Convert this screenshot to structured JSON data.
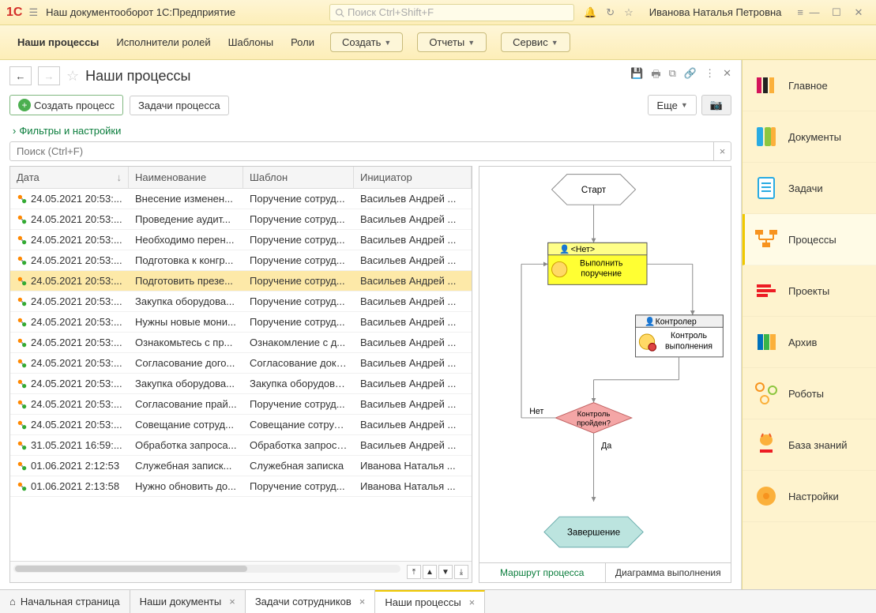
{
  "titlebar": {
    "app_title": "Наш документооборот 1С:Предприятие",
    "search_placeholder": "Поиск Ctrl+Shift+F",
    "username": "Иванова Наталья Петровна"
  },
  "toolbar": {
    "tabs": [
      "Наши процессы",
      "Исполнители ролей",
      "Шаблоны",
      "Роли"
    ],
    "create": "Создать",
    "reports": "Отчеты",
    "service": "Сервис"
  },
  "page": {
    "title": "Наши процессы",
    "create_process": "Создать процесс",
    "process_tasks": "Задачи процесса",
    "more": "Еще",
    "filters": "Фильтры и настройки",
    "search_placeholder": "Поиск (Ctrl+F)"
  },
  "table": {
    "columns": {
      "date": "Дата",
      "name": "Наименование",
      "template": "Шаблон",
      "initiator": "Инициатор"
    },
    "rows": [
      {
        "date": "24.05.2021 20:53:...",
        "name": "Внесение изменен...",
        "template": "Поручение сотруд...",
        "initiator": "Васильев Андрей ..."
      },
      {
        "date": "24.05.2021 20:53:...",
        "name": "Проведение аудит...",
        "template": "Поручение сотруд...",
        "initiator": "Васильев Андрей ..."
      },
      {
        "date": "24.05.2021 20:53:...",
        "name": "Необходимо перен...",
        "template": "Поручение сотруд...",
        "initiator": "Васильев Андрей ..."
      },
      {
        "date": "24.05.2021 20:53:...",
        "name": "Подготовка к конгр...",
        "template": "Поручение сотруд...",
        "initiator": "Васильев Андрей ..."
      },
      {
        "date": "24.05.2021 20:53:...",
        "name": "Подготовить презе...",
        "template": "Поручение сотруд...",
        "initiator": "Васильев Андрей ...",
        "selected": true
      },
      {
        "date": "24.05.2021 20:53:...",
        "name": "Закупка оборудова...",
        "template": "Поручение сотруд...",
        "initiator": "Васильев Андрей ..."
      },
      {
        "date": "24.05.2021 20:53:...",
        "name": "Нужны новые мони...",
        "template": "Поручение сотруд...",
        "initiator": "Васильев Андрей ..."
      },
      {
        "date": "24.05.2021 20:53:...",
        "name": "Ознакомьтесь с пр...",
        "template": "Ознакомление с д...",
        "initiator": "Васильев Андрей ..."
      },
      {
        "date": "24.05.2021 20:53:...",
        "name": "Согласование дого...",
        "template": "Согласование доку...",
        "initiator": "Васильев Андрей ..."
      },
      {
        "date": "24.05.2021 20:53:...",
        "name": "Закупка оборудова...",
        "template": "Закупка оборудова...",
        "initiator": "Васильев Андрей ..."
      },
      {
        "date": "24.05.2021 20:53:...",
        "name": "Согласование прай...",
        "template": "Поручение сотруд...",
        "initiator": "Васильев Андрей ..."
      },
      {
        "date": "24.05.2021 20:53:...",
        "name": "Совещание сотруд...",
        "template": "Совещание сотруд...",
        "initiator": "Васильев Андрей ..."
      },
      {
        "date": "31.05.2021 16:59:...",
        "name": "Обработка запроса...",
        "template": "Обработка запроса...",
        "initiator": "Васильев Андрей ..."
      },
      {
        "date": "01.06.2021 2:12:53",
        "name": "Служебная записк...",
        "template": "Служебная записка",
        "initiator": "Иванова Наталья ..."
      },
      {
        "date": "01.06.2021 2:13:58",
        "name": "Нужно обновить до...",
        "template": "Поручение сотруд...",
        "initiator": "Иванова Наталья ..."
      }
    ]
  },
  "diagram": {
    "start": "Старт",
    "node1_header": "<Нет>",
    "node1_text1": "Выполнить",
    "node1_text2": "поручение",
    "node2_header": "Контролер",
    "node2_text1": "Контроль",
    "node2_text2": "выполнения",
    "decision1": "Контроль",
    "decision2": "пройден?",
    "no": "Нет",
    "yes": "Да",
    "end": "Завершение",
    "tab_route": "Маршрут процесса",
    "tab_exec": "Диаграмма выполнения"
  },
  "sidebar": {
    "items": [
      {
        "label": "Главное"
      },
      {
        "label": "Документы"
      },
      {
        "label": "Задачи"
      },
      {
        "label": "Процессы",
        "active": true
      },
      {
        "label": "Проекты"
      },
      {
        "label": "Архив"
      },
      {
        "label": "Роботы"
      },
      {
        "label": "База знаний"
      },
      {
        "label": "Настройки"
      }
    ]
  },
  "bottom_tabs": {
    "home": "Начальная страница",
    "tabs": [
      {
        "label": "Наши документы"
      },
      {
        "label": "Задачи сотрудников"
      },
      {
        "label": "Наши процессы",
        "active": true
      }
    ]
  }
}
